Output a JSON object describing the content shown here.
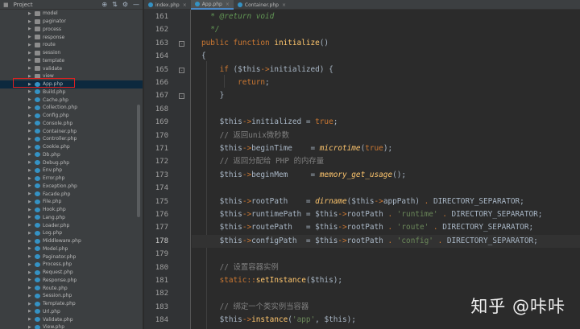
{
  "sidebar": {
    "title": "Project",
    "tools": [
      "⊕",
      "⇅",
      "⚙",
      "—"
    ],
    "items": [
      {
        "label": "model",
        "type": "folder"
      },
      {
        "label": "paginator",
        "type": "folder"
      },
      {
        "label": "process",
        "type": "folder"
      },
      {
        "label": "response",
        "type": "folder"
      },
      {
        "label": "route",
        "type": "folder"
      },
      {
        "label": "session",
        "type": "folder"
      },
      {
        "label": "template",
        "type": "folder"
      },
      {
        "label": "validate",
        "type": "folder"
      },
      {
        "label": "view",
        "type": "folder"
      },
      {
        "label": "App.php",
        "type": "php",
        "selected": true
      },
      {
        "label": "Build.php",
        "type": "php"
      },
      {
        "label": "Cache.php",
        "type": "php"
      },
      {
        "label": "Collection.php",
        "type": "php"
      },
      {
        "label": "Config.php",
        "type": "php"
      },
      {
        "label": "Console.php",
        "type": "php"
      },
      {
        "label": "Container.php",
        "type": "php"
      },
      {
        "label": "Controller.php",
        "type": "php"
      },
      {
        "label": "Cookie.php",
        "type": "php"
      },
      {
        "label": "Db.php",
        "type": "php"
      },
      {
        "label": "Debug.php",
        "type": "php"
      },
      {
        "label": "Env.php",
        "type": "php"
      },
      {
        "label": "Error.php",
        "type": "php"
      },
      {
        "label": "Exception.php",
        "type": "php"
      },
      {
        "label": "Facade.php",
        "type": "php"
      },
      {
        "label": "File.php",
        "type": "php"
      },
      {
        "label": "Hook.php",
        "type": "php"
      },
      {
        "label": "Lang.php",
        "type": "php"
      },
      {
        "label": "Loader.php",
        "type": "php"
      },
      {
        "label": "Log.php",
        "type": "php"
      },
      {
        "label": "Middleware.php",
        "type": "php"
      },
      {
        "label": "Model.php",
        "type": "php"
      },
      {
        "label": "Paginator.php",
        "type": "php"
      },
      {
        "label": "Process.php",
        "type": "php"
      },
      {
        "label": "Request.php",
        "type": "php"
      },
      {
        "label": "Response.php",
        "type": "php"
      },
      {
        "label": "Route.php",
        "type": "php"
      },
      {
        "label": "Session.php",
        "type": "php"
      },
      {
        "label": "Template.php",
        "type": "php"
      },
      {
        "label": "Url.php",
        "type": "php"
      },
      {
        "label": "Validate.php",
        "type": "php"
      },
      {
        "label": "View.php",
        "type": "php"
      }
    ]
  },
  "tabs": [
    {
      "label": "index.php",
      "active": false
    },
    {
      "label": "App.php",
      "active": true
    },
    {
      "label": "Container.php",
      "active": false
    }
  ],
  "editor": {
    "current_line": 178,
    "lines": [
      {
        "n": 161,
        "tokens": [
          [
            "doc",
            "  * @return void"
          ]
        ]
      },
      {
        "n": 162,
        "tokens": [
          [
            "doc",
            "  */"
          ]
        ]
      },
      {
        "n": 163,
        "fold": "-",
        "tokens": [
          [
            "kw",
            "public function "
          ],
          [
            "fn",
            "initialize"
          ],
          [
            "var",
            "()"
          ]
        ]
      },
      {
        "n": 164,
        "tokens": [
          [
            "var",
            "{"
          ]
        ]
      },
      {
        "n": 165,
        "fold": "-",
        "tokens": [
          [
            "var",
            "    "
          ],
          [
            "kw",
            "if "
          ],
          [
            "var",
            "("
          ],
          [
            "var",
            "$this"
          ],
          [
            "op",
            "->"
          ],
          [
            "prop",
            "initialized"
          ],
          [
            "var",
            ") {"
          ]
        ]
      },
      {
        "n": 166,
        "tokens": [
          [
            "var",
            "        "
          ],
          [
            "kw",
            "return"
          ],
          [
            "var",
            ";"
          ]
        ]
      },
      {
        "n": 167,
        "fold": "-",
        "tokens": [
          [
            "var",
            "    }"
          ]
        ]
      },
      {
        "n": 168,
        "tokens": []
      },
      {
        "n": 169,
        "tokens": [
          [
            "var",
            "    $this"
          ],
          [
            "op",
            "->"
          ],
          [
            "prop",
            "initialized "
          ],
          [
            "var",
            "= "
          ],
          [
            "kw",
            "true"
          ],
          [
            "var",
            ";"
          ]
        ]
      },
      {
        "n": 170,
        "tokens": [
          [
            "cm",
            "    // 返回unix微秒数"
          ]
        ]
      },
      {
        "n": 171,
        "tokens": [
          [
            "var",
            "    $this"
          ],
          [
            "op",
            "->"
          ],
          [
            "prop",
            "beginTime    "
          ],
          [
            "var",
            "= "
          ],
          [
            "it",
            "microtime"
          ],
          [
            "var",
            "("
          ],
          [
            "kw",
            "true"
          ],
          [
            "var",
            ");"
          ]
        ]
      },
      {
        "n": 172,
        "tokens": [
          [
            "cm",
            "    // 返回分配给 PHP 的内存量"
          ]
        ]
      },
      {
        "n": 173,
        "tokens": [
          [
            "var",
            "    $this"
          ],
          [
            "op",
            "->"
          ],
          [
            "prop",
            "beginMem     "
          ],
          [
            "var",
            "= "
          ],
          [
            "it",
            "memory_get_usage"
          ],
          [
            "var",
            "();"
          ]
        ]
      },
      {
        "n": 174,
        "tokens": []
      },
      {
        "n": 175,
        "tokens": [
          [
            "var",
            "    $this"
          ],
          [
            "op",
            "->"
          ],
          [
            "prop",
            "rootPath    "
          ],
          [
            "var",
            "= "
          ],
          [
            "it",
            "dirname"
          ],
          [
            "var",
            "($this"
          ],
          [
            "op",
            "->"
          ],
          [
            "prop",
            "appPath"
          ],
          [
            "var",
            ") "
          ],
          [
            "op",
            ". "
          ],
          [
            "var",
            "DIRECTORY_SEPARATOR;"
          ]
        ]
      },
      {
        "n": 176,
        "tokens": [
          [
            "var",
            "    $this"
          ],
          [
            "op",
            "->"
          ],
          [
            "prop",
            "runtimePath "
          ],
          [
            "var",
            "= $this"
          ],
          [
            "op",
            "->"
          ],
          [
            "prop",
            "rootPath "
          ],
          [
            "op",
            ". "
          ],
          [
            "str",
            "'runtime' "
          ],
          [
            "op",
            ". "
          ],
          [
            "var",
            "DIRECTORY_SEPARATOR;"
          ]
        ]
      },
      {
        "n": 177,
        "tokens": [
          [
            "var",
            "    $this"
          ],
          [
            "op",
            "->"
          ],
          [
            "prop",
            "routePath   "
          ],
          [
            "var",
            "= $this"
          ],
          [
            "op",
            "->"
          ],
          [
            "prop",
            "rootPath "
          ],
          [
            "op",
            ". "
          ],
          [
            "str",
            "'route' "
          ],
          [
            "op",
            ". "
          ],
          [
            "var",
            "DIRECTORY_SEPARATOR;"
          ]
        ]
      },
      {
        "n": 178,
        "tokens": [
          [
            "var",
            "    $this"
          ],
          [
            "op",
            "->"
          ],
          [
            "prop",
            "configPath  "
          ],
          [
            "var",
            "= $this"
          ],
          [
            "op",
            "->"
          ],
          [
            "prop",
            "rootPath "
          ],
          [
            "op",
            ". "
          ],
          [
            "str",
            "'config' "
          ],
          [
            "op",
            ". "
          ],
          [
            "var",
            "DIRECTORY_SEPARATOR;"
          ]
        ]
      },
      {
        "n": 179,
        "tokens": []
      },
      {
        "n": 180,
        "tokens": [
          [
            "cm",
            "    // 设置容器实例"
          ]
        ]
      },
      {
        "n": 181,
        "tokens": [
          [
            "var",
            "    "
          ],
          [
            "static",
            "static"
          ],
          [
            "op",
            "::"
          ],
          [
            "fn",
            "setInstance"
          ],
          [
            "var",
            "($this);"
          ]
        ]
      },
      {
        "n": 182,
        "tokens": []
      },
      {
        "n": 183,
        "tokens": [
          [
            "cm",
            "    // 绑定一个类实例当容器"
          ]
        ]
      },
      {
        "n": 184,
        "tokens": [
          [
            "var",
            "    $this"
          ],
          [
            "op",
            "->"
          ],
          [
            "fn",
            "instance"
          ],
          [
            "var",
            "("
          ],
          [
            "str",
            "'app'"
          ],
          [
            "var",
            ", $this);"
          ]
        ]
      }
    ]
  },
  "watermark": "知乎 @咔咔"
}
